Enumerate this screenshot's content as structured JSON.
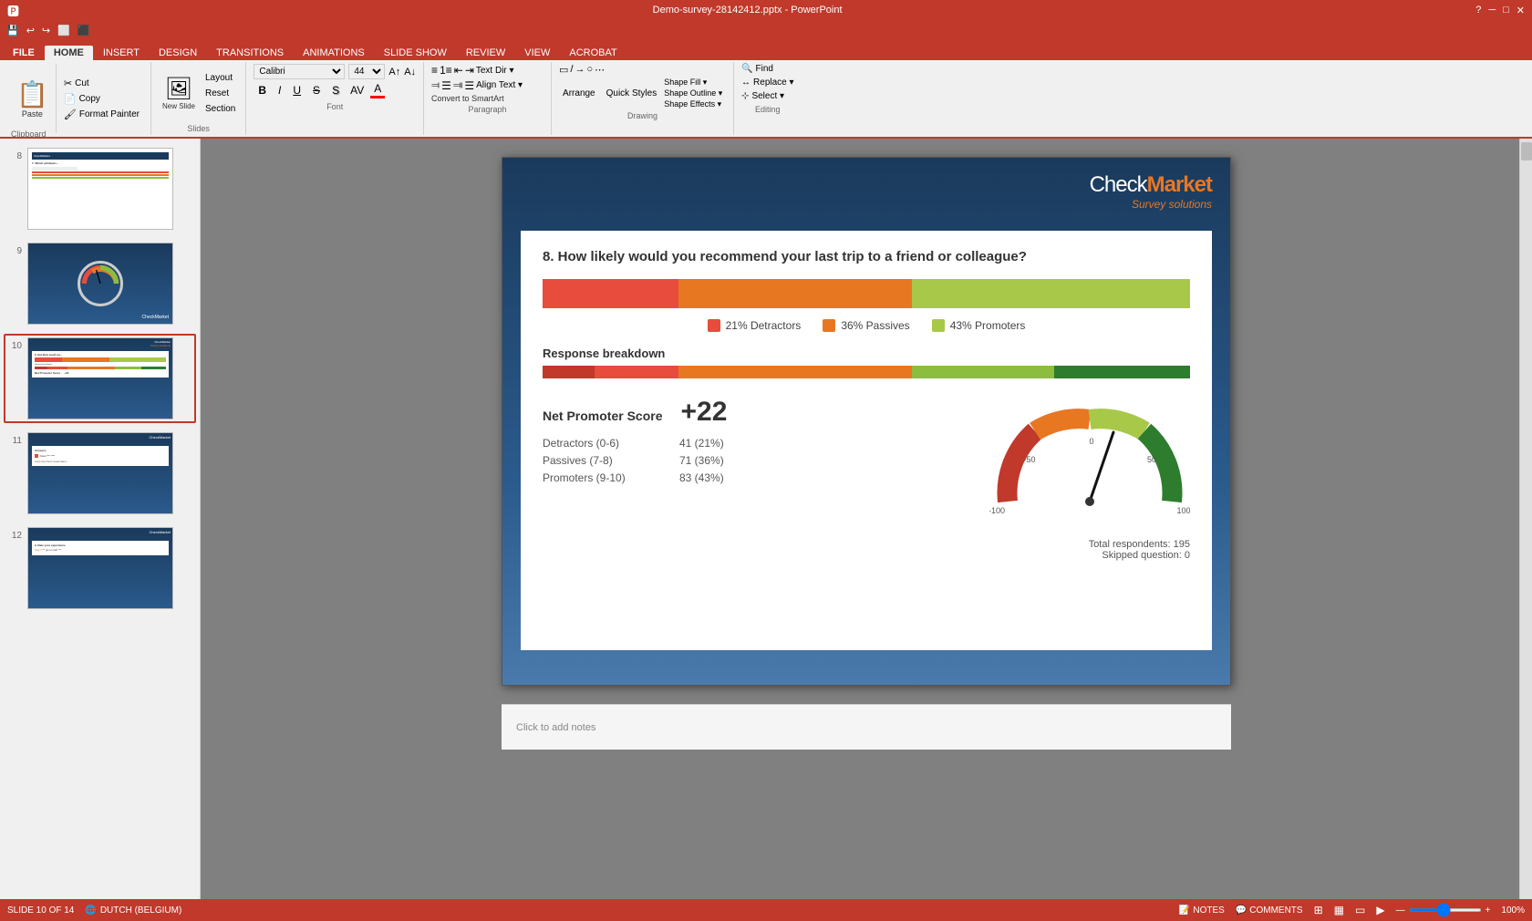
{
  "window": {
    "title": "Demo-survey-28142412.pptx - PowerPoint",
    "controls": [
      "?",
      "─",
      "□",
      "✕"
    ]
  },
  "qat": {
    "buttons": [
      "💾",
      "↩",
      "↪",
      "⬜",
      "⬛"
    ]
  },
  "ribbon": {
    "tabs": [
      "FILE",
      "HOME",
      "INSERT",
      "DESIGN",
      "TRANSITIONS",
      "ANIMATIONS",
      "SLIDE SHOW",
      "REVIEW",
      "VIEW",
      "ACROBAT"
    ],
    "active_tab": "HOME",
    "groups": {
      "clipboard": {
        "label": "Clipboard",
        "paste": "Paste",
        "cut": "Cut",
        "copy": "Copy",
        "format_painter": "Format Painter"
      },
      "slides": {
        "label": "Slides",
        "new_slide": "New Slide",
        "layout": "Layout",
        "reset": "Reset",
        "section": "Section"
      },
      "font": {
        "label": "Font",
        "family": "Calibri",
        "size": "44"
      },
      "paragraph": {
        "label": "Paragraph",
        "align_text": "Align Text ▾",
        "convert_to_smartart": "Convert to SmartArt"
      },
      "drawing": {
        "label": "Drawing",
        "arrange": "Arrange",
        "quick_styles": "Quick Styles",
        "shape_fill": "Shape Fill ▾",
        "shape_outline": "Shape Outline ▾",
        "shape_effects": "Shape Effects ▾"
      },
      "editing": {
        "label": "Editing",
        "find": "Find",
        "replace": "Replace ▾",
        "select": "Select ▾"
      }
    }
  },
  "slides": [
    {
      "num": 8,
      "active": false
    },
    {
      "num": 9,
      "active": false
    },
    {
      "num": 10,
      "active": true
    },
    {
      "num": 11,
      "active": false
    },
    {
      "num": 12,
      "active": false
    }
  ],
  "slide": {
    "logo": "CheckMarket",
    "logo_check": "Check",
    "logo_market": "Market",
    "tagline": "Survey solutions",
    "question": "8.  How likely would you recommend your last trip to a friend or colleague?",
    "bar": {
      "detractors_pct": 21,
      "passives_pct": 36,
      "promoters_pct": 43
    },
    "legend": {
      "detractors": "21% Detractors",
      "passives": "36% Passives",
      "promoters": "43% Promoters"
    },
    "response_breakdown": {
      "label": "Response breakdown"
    },
    "nps": {
      "label": "Net Promoter Score",
      "score": "+22",
      "detractors_label": "Detractors (0-6)",
      "detractors_value": "41 (21%)",
      "passives_label": "Passives (7-8)",
      "passives_value": "71 (36%)",
      "promoters_label": "Promoters (9-10)",
      "promoters_value": "83 (43%)"
    },
    "gauge": {
      "minus100": "-100",
      "minus50": "-50",
      "zero": "0",
      "plus50": "50",
      "plus100": "100"
    },
    "totals": {
      "respondents": "Total respondents: 195",
      "skipped": "Skipped question: 0"
    }
  },
  "notes": {
    "placeholder": "Click to add notes"
  },
  "status_bar": {
    "slide_info": "SLIDE 10 OF 14",
    "language": "DUTCH (BELGIUM)",
    "notes": "NOTES",
    "comments": "COMMENTS",
    "zoom": "100%",
    "view_icons": [
      "⊞",
      "≡",
      "▦",
      "▭"
    ]
  }
}
